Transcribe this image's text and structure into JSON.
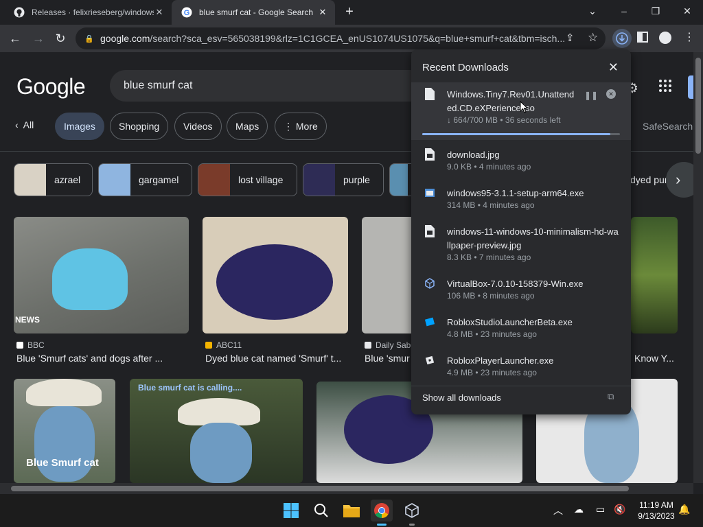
{
  "tabs": [
    {
      "title": "Releases · felixrieseberg/windows"
    },
    {
      "title": "blue smurf cat - Google Search"
    }
  ],
  "url": {
    "host": "google.com",
    "path": "/search?sca_esv=565038199&rlz=1C1GCEA_enUS1074US1075&q=blue+smurf+cat&tbm=isch..."
  },
  "search": {
    "logo": "Google",
    "query": "blue smurf cat"
  },
  "filters": [
    {
      "label": "All"
    },
    {
      "label": "Images"
    },
    {
      "label": "Shopping"
    },
    {
      "label": "Videos"
    },
    {
      "label": "Maps"
    },
    {
      "label": "More"
    }
  ],
  "safesearch": "SafeSearch",
  "suggestions": [
    {
      "label": "azrael"
    },
    {
      "label": "gargamel"
    },
    {
      "label": "lost village"
    },
    {
      "label": "purple"
    },
    {
      "label": "dyed purp"
    }
  ],
  "results": [
    {
      "source": "BBC",
      "caption": "Blue 'Smurf cats' and dogs after ...",
      "overlay": "NEWS"
    },
    {
      "source": "ABC11",
      "caption": "Dyed blue cat named 'Smurf' t..."
    },
    {
      "source": "Daily Sab",
      "caption": "Blue 'smur"
    },
    {
      "source": "",
      "caption": "Know Y..."
    }
  ],
  "row2": [
    {
      "overlay": "Blue Smurf cat"
    },
    {
      "overlay": "Blue smurf cat is calling...."
    }
  ],
  "downloads": {
    "title": "Recent Downloads",
    "show_all": "Show all downloads",
    "active": {
      "name": "Windows.Tiny7.Rev01.Unattended.CD.eXPerience.iso",
      "status": "↓ 664/700 MB • 36 seconds left",
      "progress": 0.95
    },
    "items": [
      {
        "name": "download.jpg",
        "meta": "9.0 KB • 4 minutes ago"
      },
      {
        "name": "windows95-3.1.1-setup-arm64.exe",
        "meta": "314 MB • 4 minutes ago"
      },
      {
        "name": "windows-11-windows-10-minimalism-hd-wallpaper-preview.jpg",
        "meta": "8.3 KB • 7 minutes ago"
      },
      {
        "name": "VirtualBox-7.0.10-158379-Win.exe",
        "meta": "106 MB • 8 minutes ago"
      },
      {
        "name": "RobloxStudioLauncherBeta.exe",
        "meta": "4.8 MB • 23 minutes ago"
      },
      {
        "name": "RobloxPlayerLauncher.exe",
        "meta": "4.9 MB • 23 minutes ago"
      }
    ]
  },
  "clock": {
    "time": "11:19 AM",
    "date": "9/13/2023"
  }
}
